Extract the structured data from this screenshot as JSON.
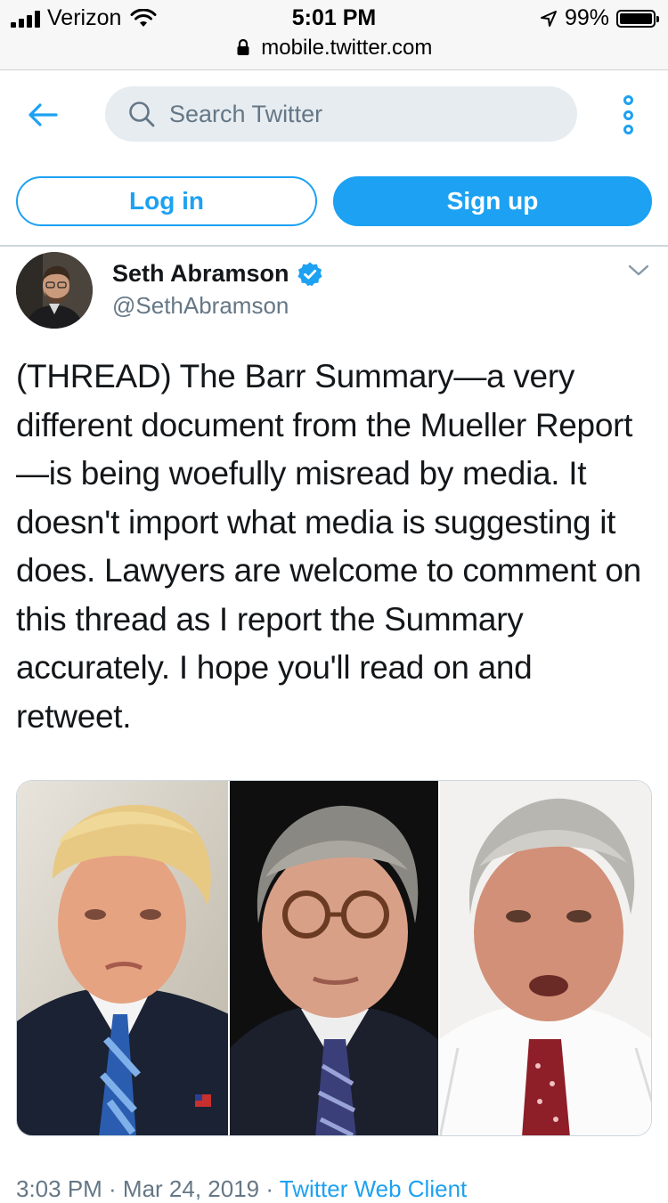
{
  "status_bar": {
    "carrier": "Verizon",
    "time": "5:01 PM",
    "battery": "99%",
    "battery_level": 0.99
  },
  "browser": {
    "url": "mobile.twitter.com"
  },
  "header": {
    "search_placeholder": "Search Twitter"
  },
  "auth": {
    "login_label": "Log in",
    "signup_label": "Sign up"
  },
  "tweet": {
    "display_name": "Seth Abramson",
    "handle": "@SethAbramson",
    "text": "(THREAD) The Barr Summary—a very different document from the Mueller Report—is being woefully misread by media. It doesn't import what media is suggesting it does. Lawyers are welcome to comment on this thread as I report the Summary accurately. I hope you'll read on and retweet.",
    "timestamp_partial": "3:03 PM · Mar 24, 2019 · ",
    "source_partial": "Twitter Web Client"
  },
  "colors": {
    "accent": "#1da1f2",
    "text": "#14171a",
    "secondary": "#657786",
    "search_bg": "#e6ecf0",
    "divider": "#ccd6dd"
  },
  "icons": {
    "back": "arrow-left-icon",
    "search": "search-icon",
    "more": "more-vertical-icon",
    "verified": "verified-badge-icon",
    "caret": "chevron-down-icon",
    "lock": "lock-icon",
    "location": "location-arrow-icon"
  }
}
